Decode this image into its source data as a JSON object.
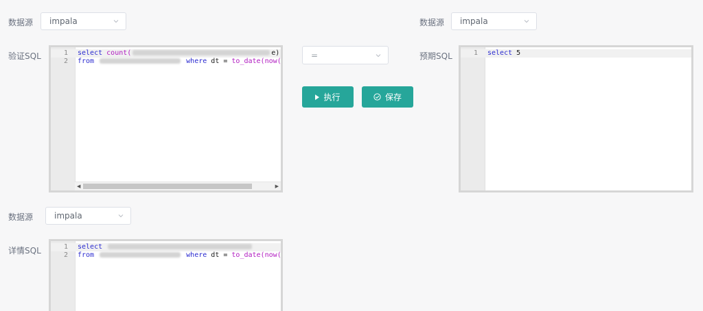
{
  "panel_left": {
    "datasource_label": "数据源",
    "datasource_value": "impala",
    "sql_label": "验证SQL",
    "editor": {
      "line_numbers": [
        "1",
        "2"
      ],
      "line1": {
        "kw": "select",
        "fn": "count(",
        "tail": "e)"
      },
      "line2": {
        "kw": "from",
        "kw2": "where",
        "mid": "dt = ",
        "fn": "to_date(",
        "fn2": "now("
      }
    }
  },
  "operator_select": {
    "value": "="
  },
  "actions": {
    "run_label": "执行",
    "save_label": "保存"
  },
  "panel_right": {
    "datasource_label": "数据源",
    "datasource_value": "impala",
    "sql_label": "预期SQL",
    "editor": {
      "line_numbers": [
        "1"
      ],
      "line1": {
        "kw": "select",
        "rest": "5"
      }
    }
  },
  "panel_bottom": {
    "datasource_label": "数据源",
    "datasource_value": "impala",
    "sql_label": "详情SQL",
    "editor": {
      "line_numbers": [
        "1",
        "2"
      ],
      "line1": {
        "kw": "select"
      },
      "line2": {
        "kw": "from",
        "kw2": "where",
        "mid": "dt = ",
        "fn": "to_date(",
        "fn2": "now("
      }
    }
  },
  "colors": {
    "primary": "#26a69a",
    "keyword": "#2b2bd0",
    "function": "#b01ac0",
    "editor_border": "#d6d6d6",
    "background": "#f7f7f8"
  }
}
